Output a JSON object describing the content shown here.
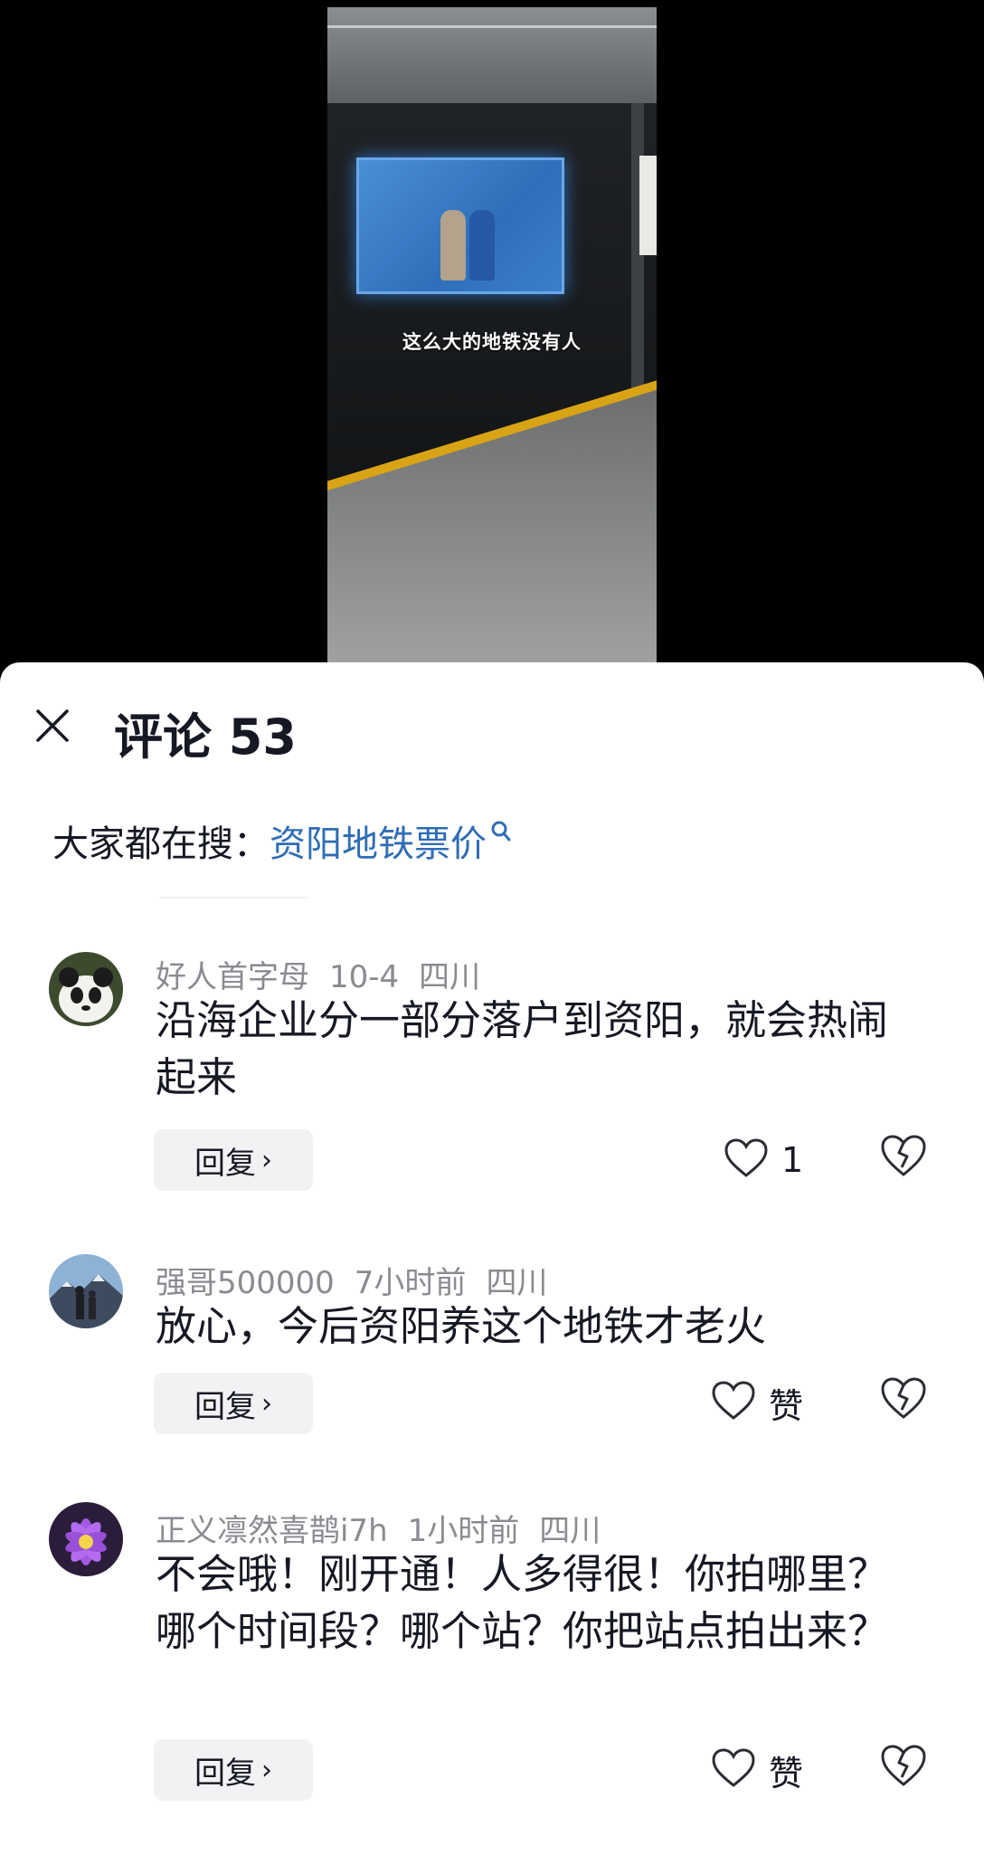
{
  "video": {
    "caption": "这么大的地铁没有人"
  },
  "sheet": {
    "title": "评论 53",
    "search_prefix": "大家都在搜：",
    "search_term": "资阳地铁票价"
  },
  "comments": [
    {
      "username": "好人首字母",
      "date": "10-4",
      "location": "四川",
      "text": "沿海企业分一部分落户到资阳，就会热闹起来",
      "reply_label": "回复",
      "like_label": "1"
    },
    {
      "username": "强哥500000",
      "date": "7小时前",
      "location": "四川",
      "text": "放心，今后资阳养这个地铁才老火",
      "reply_label": "回复",
      "like_label": "赞"
    },
    {
      "username": "正义凛然喜鹊i7h",
      "date": "1小时前",
      "location": "四川",
      "text": "不会哦！刚开通！人多得很！你拍哪里？哪个时间段？哪个站？你把站点拍出来？",
      "reply_label": "回复",
      "like_label": "赞"
    }
  ]
}
